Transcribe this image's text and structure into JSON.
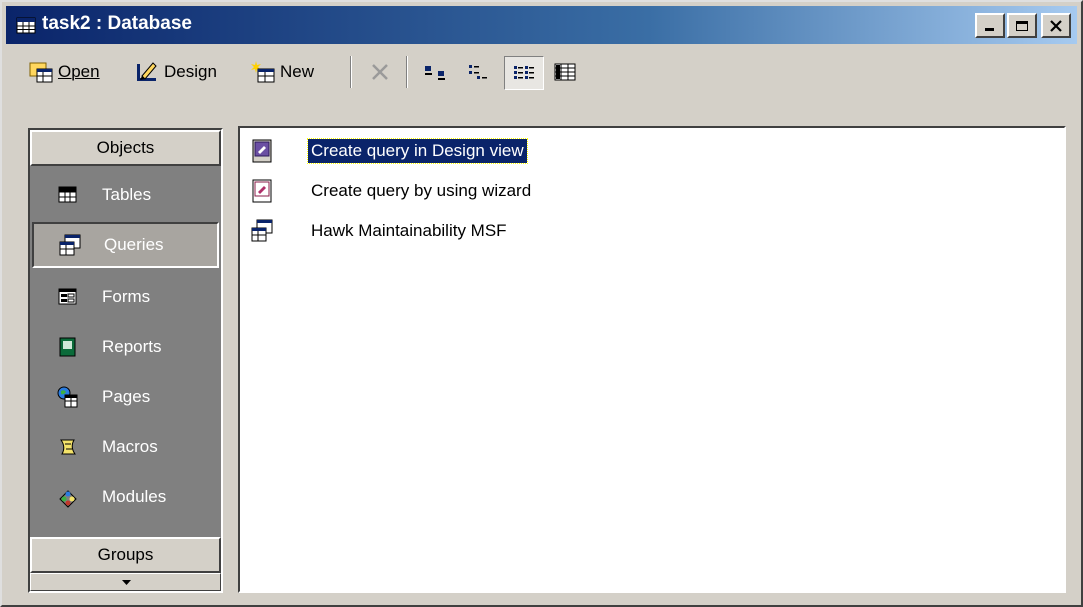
{
  "window": {
    "title": "task2 : Database",
    "controls": [
      "minimize",
      "maximize",
      "close"
    ]
  },
  "toolbar": {
    "open_label": "Open",
    "design_label": "Design",
    "new_label": "New",
    "icons": [
      "delete-icon",
      "large-icons-view-icon",
      "small-icons-view-icon",
      "list-view-icon",
      "details-view-icon"
    ],
    "pressed_view": "list-view"
  },
  "sidebar": {
    "objects_header": "Objects",
    "groups_header": "Groups",
    "items": [
      {
        "label": "Tables",
        "icon": "table-icon"
      },
      {
        "label": "Queries",
        "icon": "query-icon"
      },
      {
        "label": "Forms",
        "icon": "form-icon"
      },
      {
        "label": "Reports",
        "icon": "report-icon"
      },
      {
        "label": "Pages",
        "icon": "page-icon"
      },
      {
        "label": "Macros",
        "icon": "macro-icon"
      },
      {
        "label": "Modules",
        "icon": "module-icon"
      }
    ],
    "selected": "Queries"
  },
  "list": {
    "items": [
      {
        "label": "Create query in Design view",
        "icon": "design-view-shortcut-icon"
      },
      {
        "label": "Create query by using wizard",
        "icon": "wizard-shortcut-icon"
      },
      {
        "label": "Hawk Maintainability MSF",
        "icon": "query-icon"
      }
    ],
    "selected": "Create query in Design view"
  },
  "colors": {
    "titlebar_start": "#0a246a",
    "titlebar_end": "#a6caf0",
    "chrome": "#d4d0c8",
    "sidebar_bg": "#808080",
    "selection": "#0a246a"
  }
}
